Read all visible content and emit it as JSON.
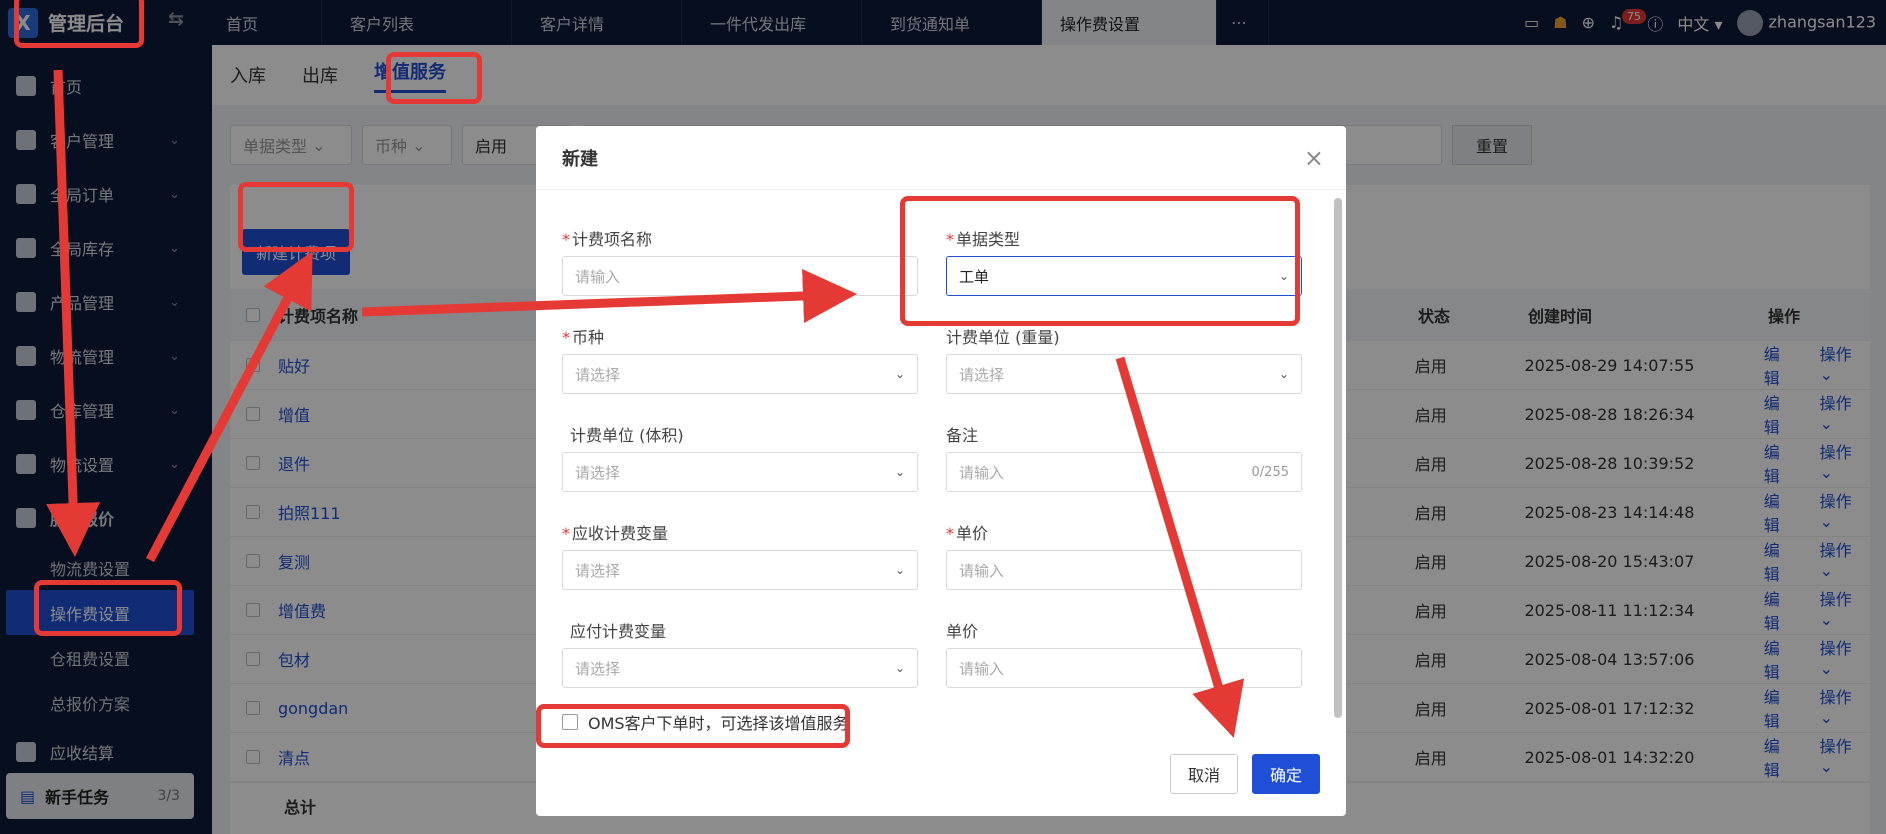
{
  "app": {
    "title": "管理后台",
    "logo_mark": "X"
  },
  "topbar": {
    "tabs": [
      "首页",
      "客户列表",
      "客户详情",
      "一件代发出库",
      "到货通知单",
      "操作费设置",
      "⋯"
    ],
    "active_tab": "操作费设置",
    "notification_count": "75",
    "language": "中文",
    "username": "zhangsan123"
  },
  "sidebar": {
    "items": [
      {
        "label": "首页",
        "icon": "home-icon"
      },
      {
        "label": "客户管理",
        "icon": "users-icon"
      },
      {
        "label": "全局订单",
        "icon": "clipboard-icon"
      },
      {
        "label": "全局库存",
        "icon": "warehouse-icon"
      },
      {
        "label": "产品管理",
        "icon": "bag-icon"
      },
      {
        "label": "物流管理",
        "icon": "truck-icon"
      },
      {
        "label": "仓库管理",
        "icon": "building-icon"
      },
      {
        "label": "物流设置",
        "icon": "box-icon"
      },
      {
        "label": "服务报价",
        "icon": "doc-icon"
      }
    ],
    "subitems": [
      "物流费设置",
      "操作费设置",
      "仓租费设置",
      "总报价方案"
    ],
    "active_subitem": "操作费设置",
    "bottom_item": "应收结算",
    "newbie": {
      "label": "新手任务",
      "count": "3/3"
    }
  },
  "subtabs": [
    "入库",
    "出库",
    "增值服务"
  ],
  "active_subtab": "增值服务",
  "filters": {
    "doc_type": "单据类型",
    "currency": "币种",
    "status": "启用",
    "reset": "重置"
  },
  "new_button": "新建计费项",
  "table": {
    "headers": {
      "name": "计费项名称",
      "status": "状态",
      "time": "创建时间",
      "op": "操作"
    },
    "rows": [
      {
        "name": "贴好",
        "status": "启用",
        "time": "2025-08-29 14:07:55"
      },
      {
        "name": "增值",
        "status": "启用",
        "time": "2025-08-28 18:26:34"
      },
      {
        "name": "退件",
        "status": "启用",
        "time": "2025-08-28 10:39:52"
      },
      {
        "name": "拍照111",
        "status": "启用",
        "time": "2025-08-23 14:14:48"
      },
      {
        "name": "复测",
        "status": "启用",
        "time": "2025-08-20 15:43:07"
      },
      {
        "name": "增值费",
        "status": "启用",
        "time": "2025-08-11 11:12:34"
      },
      {
        "name": "包材",
        "status": "启用",
        "time": "2025-08-04 13:57:06"
      },
      {
        "name": "gongdan",
        "status": "启用",
        "time": "2025-08-01 17:12:32"
      },
      {
        "name": "清点",
        "status": "启用",
        "time": "2025-08-01 14:32:20"
      }
    ],
    "edit_label": "编辑",
    "op_label": "操作",
    "total_label": "总计"
  },
  "modal": {
    "title": "新建",
    "fields": {
      "name": {
        "label": "计费项名称",
        "placeholder": "请输入"
      },
      "doc_type": {
        "label": "单据类型",
        "value": "工单"
      },
      "currency": {
        "label": "币种",
        "placeholder": "请选择"
      },
      "weight_unit": {
        "label": "计费单位 (重量)",
        "placeholder": "请选择"
      },
      "volume_unit": {
        "label": "计费单位 (体积)",
        "placeholder": "请选择"
      },
      "remark": {
        "label": "备注",
        "placeholder": "请输入",
        "counter": "0/255"
      },
      "receivable_var": {
        "label": "应收计费变量",
        "placeholder": "请选择"
      },
      "unit_price": {
        "label": "单价",
        "placeholder": "请输入"
      },
      "payable_var": {
        "label": "应付计费变量",
        "placeholder": "请选择"
      },
      "unit_price2": {
        "label": "单价",
        "placeholder": "请输入"
      }
    },
    "checkbox_label": "OMS客户下单时，可选择该增值服务",
    "cancel": "取消",
    "confirm": "确定"
  },
  "colors": {
    "primary": "#1f4fd6",
    "nav_bg": "#0c1b3a",
    "annotation": "#e53935"
  }
}
